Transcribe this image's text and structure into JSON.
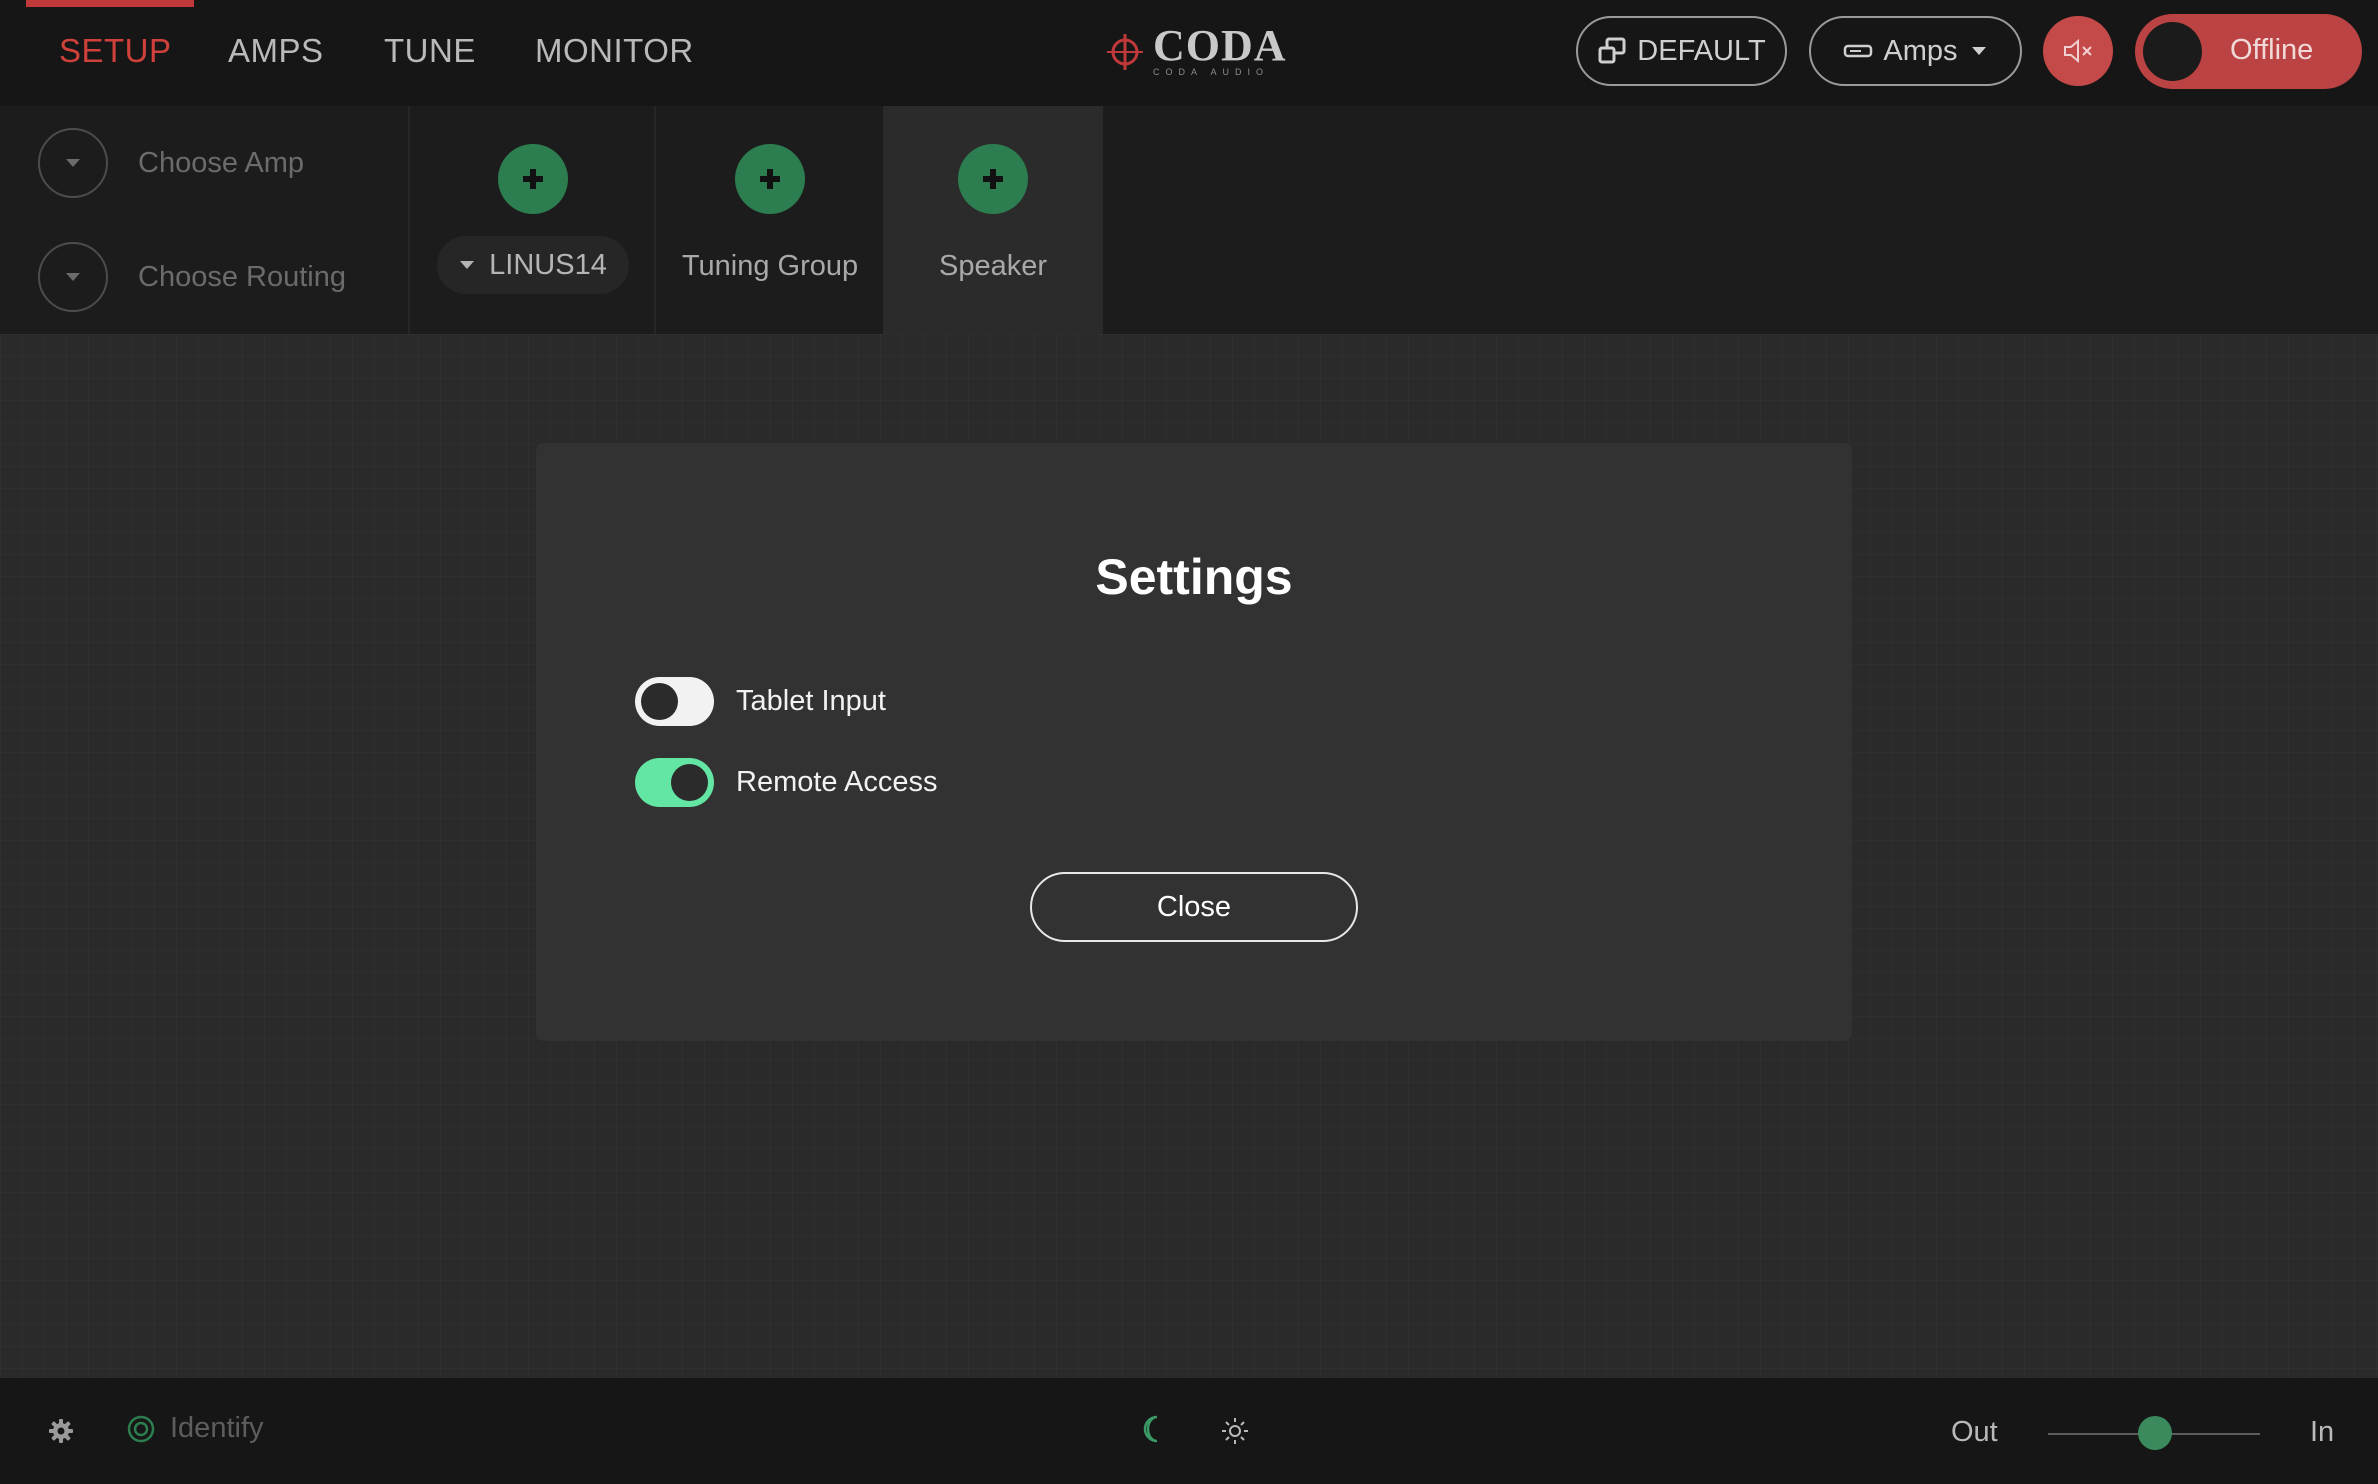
{
  "nav": {
    "tabs": [
      {
        "label": "SETUP",
        "active": true
      },
      {
        "label": "AMPS",
        "active": false
      },
      {
        "label": "TUNE",
        "active": false
      },
      {
        "label": "MONITOR",
        "active": false
      }
    ]
  },
  "brand": {
    "name": "CODA",
    "sub": "CODA AUDIO"
  },
  "header": {
    "default_label": "DEFAULT",
    "amps_dropdown_label": "Amps",
    "offline_label": "Offline"
  },
  "chooser": {
    "amp_label": "Choose Amp",
    "routing_label": "Choose Routing"
  },
  "slots": {
    "amp_model": "LINUS14",
    "tuning_group": "Tuning Group",
    "speaker": "Speaker"
  },
  "modal": {
    "title": "Settings",
    "settings": [
      {
        "label": "Tablet Input",
        "enabled": false
      },
      {
        "label": "Remote Access",
        "enabled": true
      }
    ],
    "close_label": "Close"
  },
  "footer": {
    "identify_label": "Identify",
    "out_label": "Out",
    "in_label": "In",
    "slider_value": 0.5
  },
  "colors": {
    "accent_red": "#c0393a",
    "accent_green": "#2c7d4f",
    "toggle_on": "#63e6a3",
    "background": "#2a2a2a"
  },
  "icons": {
    "settings": "gear-icon",
    "identify": "target-icon",
    "dark_mode": "moon-icon",
    "light_mode": "sun-icon",
    "mute": "speaker-mute-icon",
    "default": "windows-icon",
    "amps": "amp-rack-icon"
  }
}
